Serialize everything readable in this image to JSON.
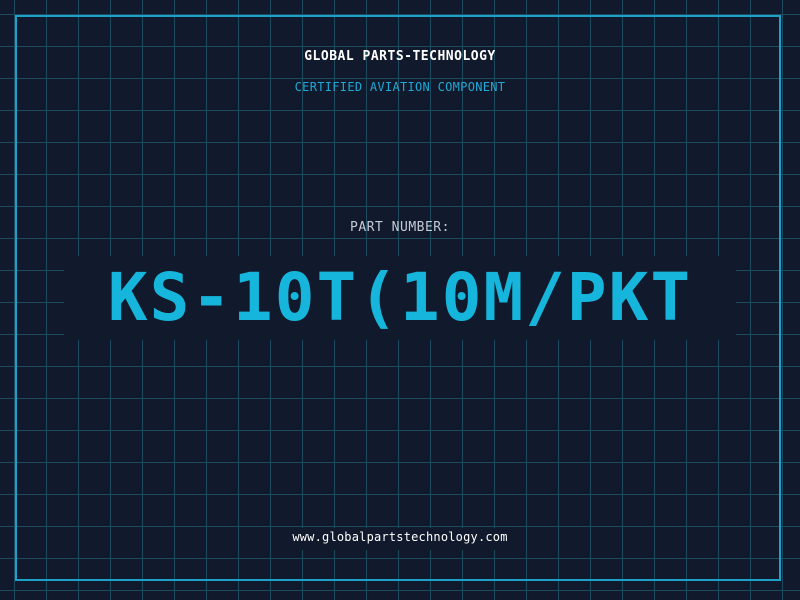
{
  "header": {
    "brand": "GLOBAL PARTS-TECHNOLOGY",
    "subtitle": "CERTIFIED AVIATION COMPONENT"
  },
  "part": {
    "label": "PART NUMBER:",
    "number": "KS-10T(10M/PKT"
  },
  "footer": {
    "url": "www.globalpartstechnology.com"
  },
  "colors": {
    "background": "#111a2c",
    "grid": "#1d4a5e",
    "accent": "#16b6dc",
    "text": "#ffffff"
  }
}
